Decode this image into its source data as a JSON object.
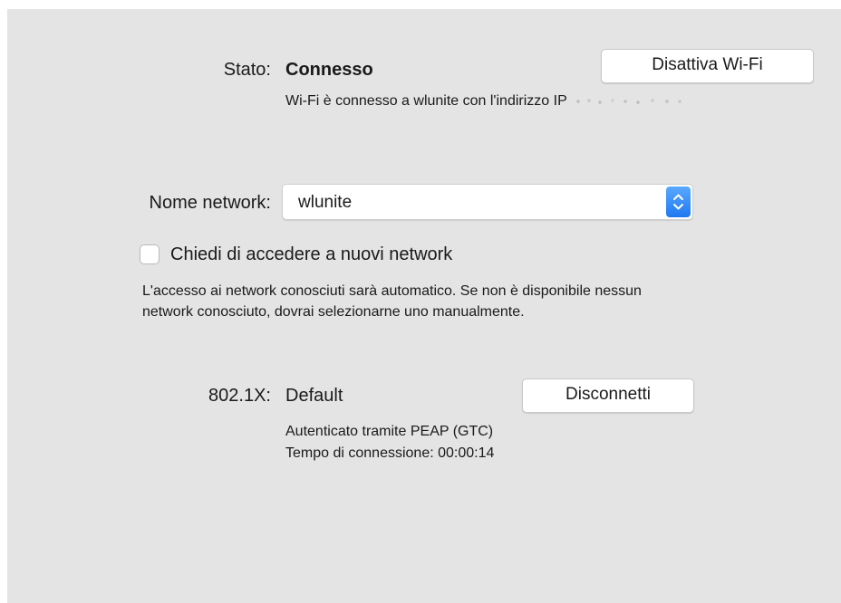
{
  "status": {
    "label": "Stato:",
    "value": "Connesso",
    "detail": "Wi-Fi è connesso a wlunite con l'indirizzo IP",
    "toggle_button": "Disattiva Wi-Fi"
  },
  "network": {
    "label": "Nome network:",
    "selected": "wlunite"
  },
  "ask_join": {
    "label": "Chiedi di accedere a nuovi network",
    "checked": false,
    "help": "L'accesso ai network conosciuti sarà automatico. Se non è disponibile nessun network conosciuto, dovrai selezionarne uno manualmente."
  },
  "auth": {
    "label": "802.1X:",
    "value": "Default",
    "disconnect_button": "Disconnetti",
    "method": "Autenticato tramite PEAP (GTC)",
    "connection_time": "Tempo di connessione: 00:00:14"
  },
  "colors": {
    "panel_background": "#e4e4e4",
    "popup_accent": "#2c84f7"
  },
  "icons": {
    "popup_arrows": "chevron-up-down-icon"
  }
}
